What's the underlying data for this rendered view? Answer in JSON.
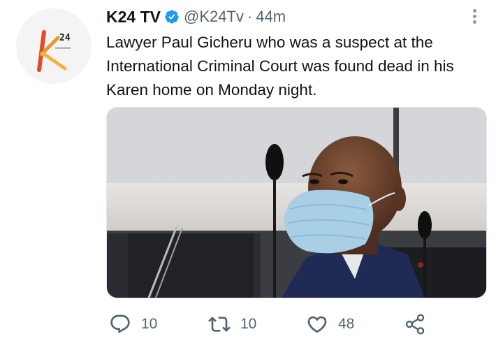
{
  "tweet": {
    "author_name": "K24 TV",
    "handle": "@K24Tv",
    "separator": "·",
    "time": "44m",
    "text": "Lawyer Paul Gicheru who was a suspect at the International Criminal Court was found dead in his Karen home on Monday night.",
    "avatar_logo_text": "24",
    "verified": true
  },
  "actions": {
    "reply_count": "10",
    "retweet_count": "10",
    "like_count": "48"
  },
  "icons": {
    "reply": "reply-icon",
    "retweet": "retweet-icon",
    "like": "heart-icon",
    "share": "share-icon",
    "verified": "verified-badge-icon",
    "more": "more-options-icon"
  },
  "colors": {
    "verified_blue": "#1d9bf0",
    "secondary_text": "#536471",
    "brand_orange": "#e9962a",
    "brand_red": "#d1342b"
  }
}
